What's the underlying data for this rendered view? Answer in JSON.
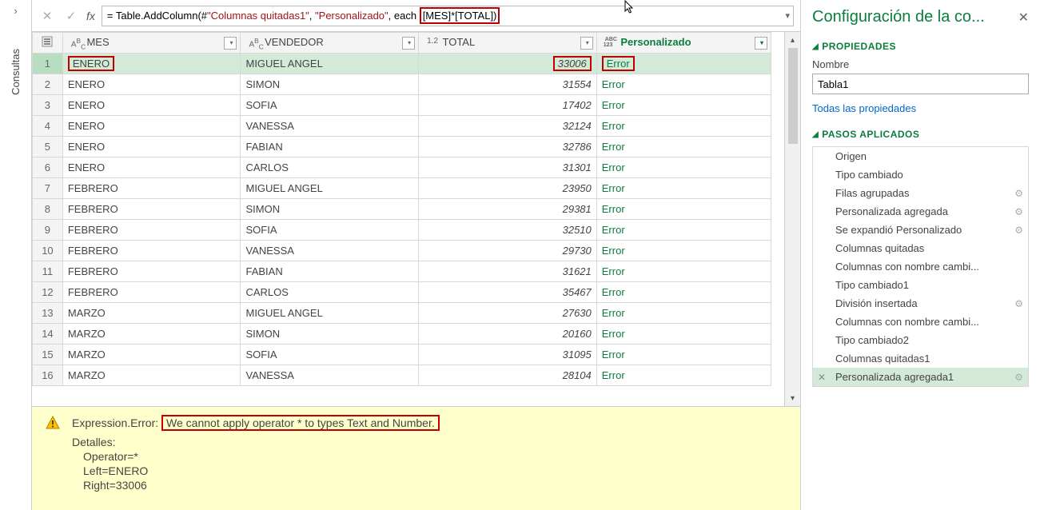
{
  "sidebar": {
    "label": "Consultas"
  },
  "formula": {
    "prefix": "= Table.AddColumn(#",
    "arg1": "\"Columnas quitadas1\"",
    "sep1": ", ",
    "arg2": "\"Personalizado\"",
    "sep2": ", each ",
    "highlight": "[MES]*[TOTAL])"
  },
  "columns": {
    "mes": "MES",
    "vendedor": "VENDEDOR",
    "total": "TOTAL",
    "personalizado": "Personalizado",
    "type_text": "ABC",
    "type_num": "1.2",
    "type_any": "ABC\n123"
  },
  "rows": [
    {
      "n": "1",
      "mes": "ENERO",
      "vendedor": "MIGUEL ANGEL",
      "total": "33006",
      "pers": "Error",
      "sel": true,
      "boxMes": true,
      "boxTotal": true,
      "boxPers": true
    },
    {
      "n": "2",
      "mes": "ENERO",
      "vendedor": "SIMON",
      "total": "31554",
      "pers": "Error"
    },
    {
      "n": "3",
      "mes": "ENERO",
      "vendedor": "SOFIA",
      "total": "17402",
      "pers": "Error"
    },
    {
      "n": "4",
      "mes": "ENERO",
      "vendedor": "VANESSA",
      "total": "32124",
      "pers": "Error"
    },
    {
      "n": "5",
      "mes": "ENERO",
      "vendedor": "FABIAN",
      "total": "32786",
      "pers": "Error"
    },
    {
      "n": "6",
      "mes": "ENERO",
      "vendedor": "CARLOS",
      "total": "31301",
      "pers": "Error"
    },
    {
      "n": "7",
      "mes": "FEBRERO",
      "vendedor": "MIGUEL ANGEL",
      "total": "23950",
      "pers": "Error"
    },
    {
      "n": "8",
      "mes": "FEBRERO",
      "vendedor": "SIMON",
      "total": "29381",
      "pers": "Error"
    },
    {
      "n": "9",
      "mes": "FEBRERO",
      "vendedor": "SOFIA",
      "total": "32510",
      "pers": "Error"
    },
    {
      "n": "10",
      "mes": "FEBRERO",
      "vendedor": "VANESSA",
      "total": "29730",
      "pers": "Error"
    },
    {
      "n": "11",
      "mes": "FEBRERO",
      "vendedor": "FABIAN",
      "total": "31621",
      "pers": "Error"
    },
    {
      "n": "12",
      "mes": "FEBRERO",
      "vendedor": "CARLOS",
      "total": "35467",
      "pers": "Error"
    },
    {
      "n": "13",
      "mes": "MARZO",
      "vendedor": "MIGUEL ANGEL",
      "total": "27630",
      "pers": "Error"
    },
    {
      "n": "14",
      "mes": "MARZO",
      "vendedor": "SIMON",
      "total": "20160",
      "pers": "Error"
    },
    {
      "n": "15",
      "mes": "MARZO",
      "vendedor": "SOFIA",
      "total": "31095",
      "pers": "Error"
    },
    {
      "n": "16",
      "mes": "MARZO",
      "vendedor": "VANESSA",
      "total": "28104",
      "pers": "Error"
    }
  ],
  "error": {
    "title_prefix": "Expression.Error: ",
    "title_boxed": "We cannot apply operator * to types Text and Number.",
    "detalles": "Detalles:",
    "line1": "Operator=*",
    "line2": "Left=ENERO",
    "line3": "Right=33006"
  },
  "right": {
    "title": "Configuración de la co...",
    "propiedades": "PROPIEDADES",
    "nombre_label": "Nombre",
    "nombre_value": "Tabla1",
    "todas": "Todas las propiedades",
    "pasos": "PASOS APLICADOS",
    "steps": [
      {
        "label": "Origen",
        "gear": false
      },
      {
        "label": "Tipo cambiado",
        "gear": false
      },
      {
        "label": "Filas agrupadas",
        "gear": true
      },
      {
        "label": "Personalizada agregada",
        "gear": true
      },
      {
        "label": "Se expandió Personalizado",
        "gear": true
      },
      {
        "label": "Columnas quitadas",
        "gear": false
      },
      {
        "label": "Columnas con nombre cambi...",
        "gear": false
      },
      {
        "label": "Tipo cambiado1",
        "gear": false
      },
      {
        "label": "División insertada",
        "gear": true
      },
      {
        "label": "Columnas con nombre cambi...",
        "gear": false
      },
      {
        "label": "Tipo cambiado2",
        "gear": false
      },
      {
        "label": "Columnas quitadas1",
        "gear": false
      },
      {
        "label": "Personalizada agregada1",
        "gear": true,
        "selected": true
      }
    ]
  }
}
